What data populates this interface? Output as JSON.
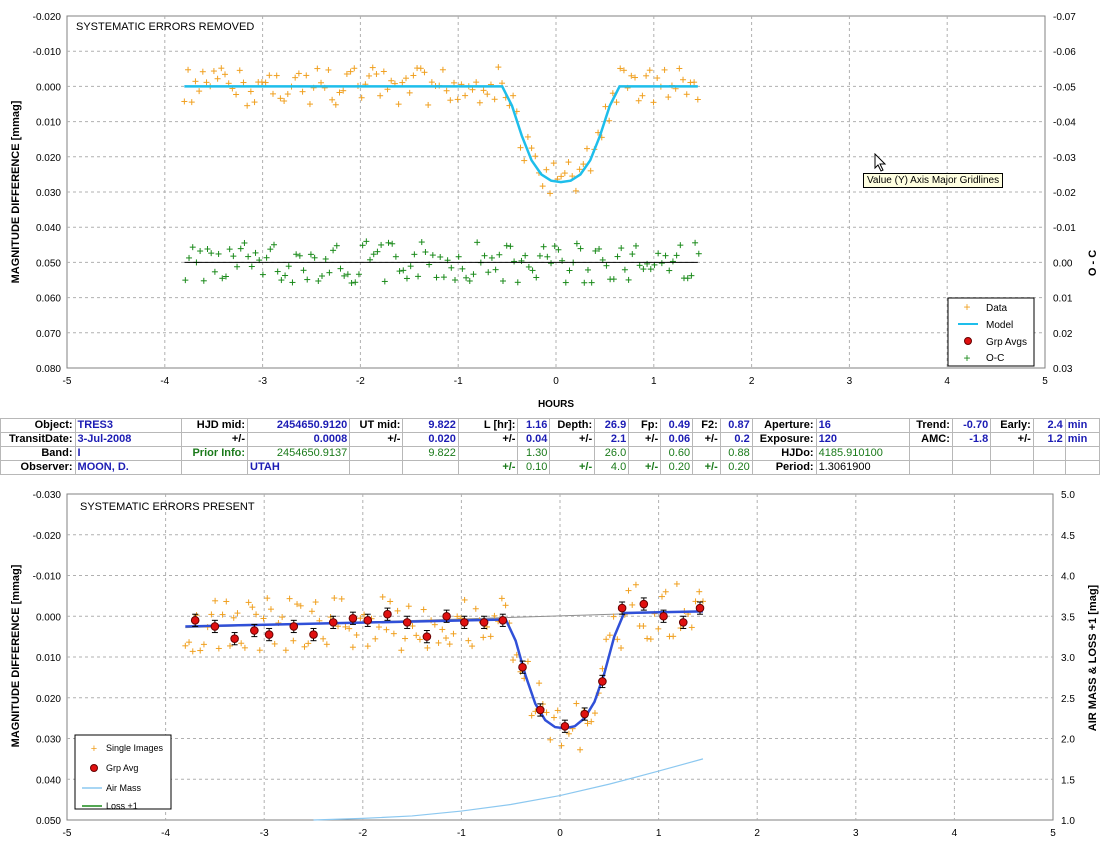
{
  "chart_data": [
    {
      "type": "scatter",
      "title": "SYSTEMATIC ERRORS REMOVED",
      "xlabel": "HOURS",
      "ylabel": "MAGNITUDE DIFFERENCE [mmag]",
      "y2label": "O - C",
      "xlim": [
        -5,
        5
      ],
      "ylim": [
        -0.02,
        0.08
      ],
      "y2lim": [
        -0.07,
        0.03
      ],
      "y_inverted": true,
      "xticks": [
        "-5",
        "-4",
        "-3",
        "-2",
        "-1",
        "0",
        "1",
        "2",
        "3",
        "4",
        "5"
      ],
      "yticks": [
        "-0.020",
        "-0.010",
        "0.000",
        "0.010",
        "0.020",
        "0.030",
        "0.040",
        "0.050",
        "0.060",
        "0.070",
        "0.080"
      ],
      "y2ticks": [
        "-0.07",
        "-0.06",
        "-0.05",
        "-0.04",
        "-0.03",
        "-0.02",
        "-0.01",
        "0.00",
        "0.01",
        "0.02",
        "0.03"
      ],
      "grid": true,
      "legend_placement": "bottom-right",
      "legend": [
        "Data",
        "Model",
        "Grp Avgs",
        "O-C"
      ],
      "series": [
        {
          "name": "Model",
          "type": "line",
          "color": "#1ebeeb",
          "x": [
            -3.8,
            -0.55,
            -0.45,
            -0.35,
            -0.25,
            -0.15,
            -0.05,
            0.05,
            0.15,
            0.25,
            0.35,
            0.45,
            0.55,
            0.65,
            1.45
          ],
          "y": [
            0.0,
            0.0,
            0.0055,
            0.014,
            0.021,
            0.025,
            0.0268,
            0.0272,
            0.0268,
            0.025,
            0.021,
            0.014,
            0.0055,
            0.0,
            0.0
          ]
        },
        {
          "name": "O-C baseline",
          "type": "line",
          "color": "#000000",
          "x": [
            -3.8,
            1.45
          ],
          "y": [
            0.05,
            0.05
          ]
        }
      ]
    },
    {
      "type": "scatter",
      "title": "SYSTEMATIC ERRORS PRESENT",
      "xlabel": "",
      "ylabel": "MAGNITUDE DIFFERENCE [mmag]",
      "y2label": "AIR MASS & LOSS +1 [mag]",
      "xlim": [
        -5,
        5
      ],
      "ylim": [
        -0.03,
        0.05
      ],
      "y2lim": [
        1.0,
        5.0
      ],
      "y_inverted": true,
      "xticks": [
        "-5",
        "-4",
        "-3",
        "-2",
        "-1",
        "0",
        "1",
        "2",
        "3",
        "4",
        "5"
      ],
      "yticks": [
        "-0.030",
        "-0.020",
        "-0.010",
        "0.000",
        "0.010",
        "0.020",
        "0.030",
        "0.040",
        "0.050"
      ],
      "y2ticks": [
        "5.0",
        "4.5",
        "4.0",
        "3.5",
        "3.0",
        "2.5",
        "2.0",
        "1.5",
        "1.0"
      ],
      "grid": true,
      "legend_placement": "bottom-left",
      "legend": [
        "Single Images",
        "Grp Avg",
        "Air Mass",
        "Loss +1"
      ],
      "series": [
        {
          "name": "Grp Avg",
          "type": "points_with_errors",
          "color": "#e01010",
          "x": [
            -3.7,
            -3.5,
            -3.3,
            -3.1,
            -2.95,
            -2.7,
            -2.5,
            -2.3,
            -2.1,
            -1.95,
            -1.75,
            -1.55,
            -1.35,
            -1.15,
            -0.97,
            -0.77,
            -0.58,
            -0.38,
            -0.2,
            0.05,
            0.25,
            0.43,
            0.63,
            0.85,
            1.05,
            1.25,
            1.42
          ],
          "y": [
            0.001,
            0.0025,
            0.0055,
            0.0035,
            0.0045,
            0.0025,
            0.0045,
            0.0015,
            0.0005,
            0.001,
            -0.0005,
            0.0015,
            0.005,
            0.0,
            0.0015,
            0.0015,
            0.001,
            0.0125,
            0.023,
            0.027,
            0.024,
            0.016,
            -0.002,
            -0.003,
            0.0,
            0.0015,
            -0.002
          ],
          "err": [
            0.0015,
            0.0015,
            0.0015,
            0.0015,
            0.0015,
            0.0015,
            0.0015,
            0.0015,
            0.0015,
            0.0015,
            0.0015,
            0.0015,
            0.0015,
            0.0015,
            0.0015,
            0.0015,
            0.0015,
            0.0015,
            0.0015,
            0.0015,
            0.0015,
            0.0015,
            0.0015,
            0.0015,
            0.0015,
            0.0015,
            0.0015
          ]
        },
        {
          "name": "Model",
          "type": "line",
          "color": "#3050d8",
          "x": [
            -3.8,
            -0.55,
            -0.45,
            -0.35,
            -0.25,
            -0.15,
            -0.05,
            0.05,
            0.15,
            0.25,
            0.35,
            0.45,
            0.55,
            0.65,
            1.45
          ],
          "y": [
            0.0025,
            0.0008,
            0.006,
            0.0145,
            0.0215,
            0.0255,
            0.0272,
            0.0275,
            0.027,
            0.025,
            0.021,
            0.014,
            0.005,
            -0.0008,
            -0.0012
          ]
        },
        {
          "name": "Air Mass",
          "type": "line",
          "color": "#8cc8f0",
          "axis": "y2",
          "x": [
            -2.5,
            -2.0,
            -1.5,
            -1.0,
            -0.5,
            0.0,
            0.5,
            1.0,
            1.45
          ],
          "y": [
            1.0,
            1.02,
            1.05,
            1.11,
            1.19,
            1.3,
            1.44,
            1.6,
            1.75
          ]
        },
        {
          "name": "Gray baseline",
          "type": "line",
          "color": "#909090",
          "x": [
            -3.8,
            1.45
          ],
          "y": [
            0.0028,
            -0.0012
          ]
        }
      ]
    }
  ],
  "info_table": {
    "row1": [
      "Object:",
      "TRES3",
      "HJD mid:",
      "2454650.9120",
      "UT mid:",
      "9.822",
      "L [hr]:",
      "1.16",
      "Depth:",
      "26.9",
      "Fp:",
      "0.49",
      "F2:",
      "0.87",
      "Aperture:",
      "16",
      "Trend:",
      "-0.70",
      "Early:",
      "2.4",
      "min"
    ],
    "row2": [
      "TransitDate:",
      "3-Jul-2008",
      "+/-",
      "0.0008",
      "+/-",
      "0.020",
      "+/-",
      "0.04",
      "+/-",
      "2.1",
      "+/-",
      "0.06",
      "+/-",
      "0.2",
      "Exposure:",
      "120",
      "AMC:",
      "-1.8",
      "+/-",
      "1.2",
      "min"
    ],
    "row3": [
      "Band:",
      "I",
      "Prior Info:",
      "2454650.9137",
      "9.822",
      "1.30",
      "26.0",
      "0.60",
      "0.88",
      "HJDo:",
      "4185.910100"
    ],
    "row4": [
      "Observer:",
      "MOON, D.",
      "UTAH",
      "+/-",
      "0.10",
      "+/-",
      "4.0",
      "+/-",
      "0.20",
      "+/-",
      "0.20",
      "Period:",
      "1.3061900"
    ]
  },
  "tooltip": "Value (Y) Axis Major Gridlines",
  "colors": {
    "data": "#f0a020",
    "oc": "#1a8a1a",
    "model1": "#1ebeeb",
    "model2": "#3050d8",
    "grp": "#e01010",
    "airmass": "#8cc8f0",
    "loss": "#1a8a1a"
  }
}
